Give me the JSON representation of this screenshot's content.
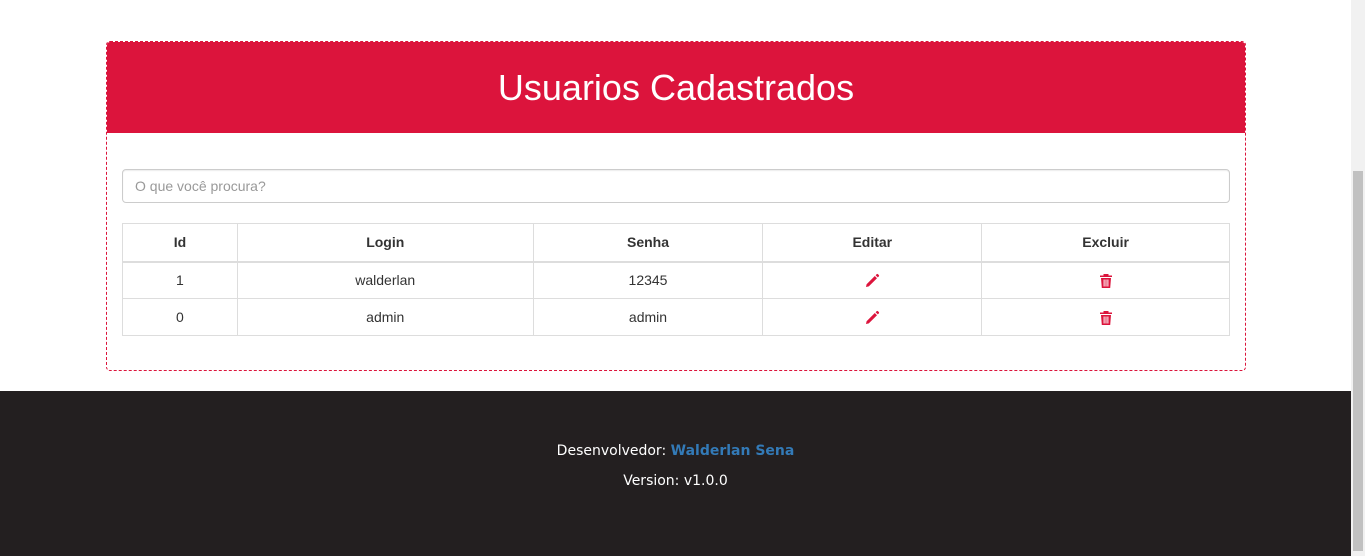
{
  "header": {
    "title": "Usuarios Cadastrados"
  },
  "search": {
    "placeholder": "O que você procura?",
    "value": ""
  },
  "table": {
    "columns": [
      "Id",
      "Login",
      "Senha",
      "Editar",
      "Excluir"
    ],
    "rows": [
      {
        "id": "1",
        "login": "walderlan",
        "senha": "12345",
        "edit_icon": "pencil-icon",
        "delete_icon": "trash-icon"
      },
      {
        "id": "0",
        "login": "admin",
        "senha": "admin",
        "edit_icon": "pencil-icon",
        "delete_icon": "trash-icon"
      }
    ]
  },
  "footer": {
    "developer_label": "Desenvolvedor:",
    "developer_name": "Walderlan Sena",
    "version_label": "Version:",
    "version_value": "v1.0.0"
  },
  "colors": {
    "accent": "#dc143c",
    "footer_bg": "#231f20",
    "link": "#337ab7"
  }
}
